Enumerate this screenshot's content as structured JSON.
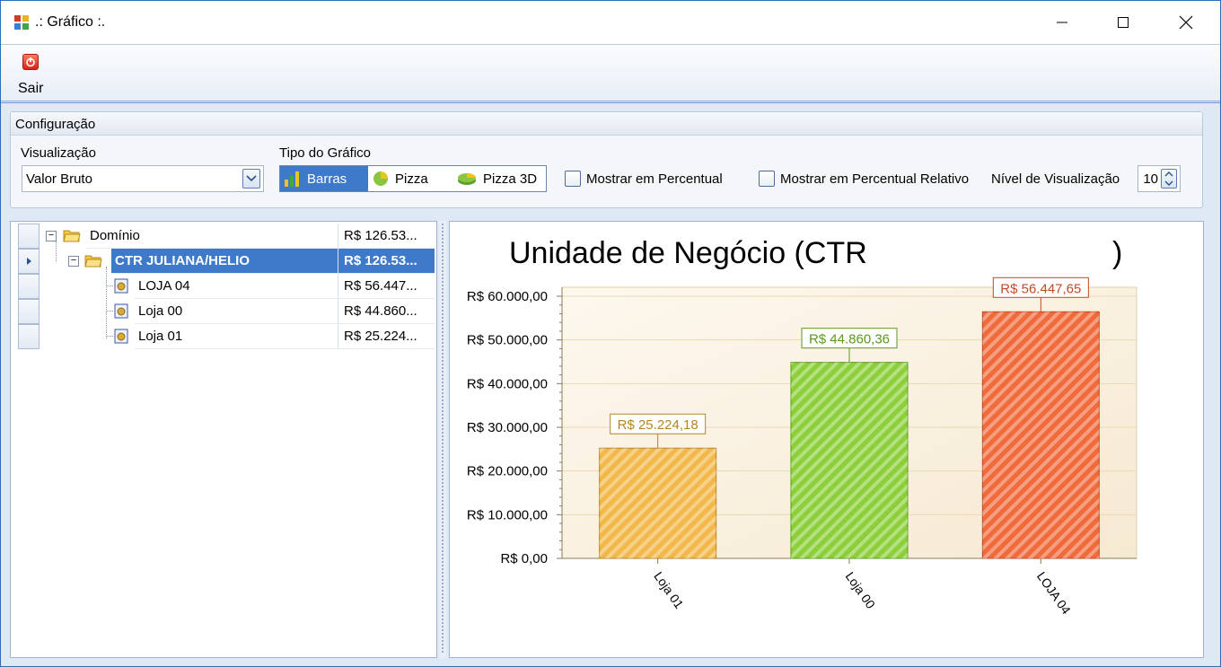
{
  "window": {
    "title": ".: Gráfico :.",
    "controls": [
      "minimize-icon",
      "maximize-icon",
      "close-icon"
    ]
  },
  "toolbar": {
    "exit_label": "Sair",
    "exit_icon": "power-icon"
  },
  "config": {
    "group_title": "Configuração",
    "visualizacao_label": "Visualização",
    "visualizacao_value": "Valor Bruto",
    "tipo_label": "Tipo do Gráfico",
    "chart_types": [
      {
        "label": "Barras",
        "icon": "bar-chart-icon",
        "selected": true
      },
      {
        "label": "Pizza",
        "icon": "pie-chart-icon",
        "selected": false
      },
      {
        "label": "Pizza 3D",
        "icon": "pie-3d-icon",
        "selected": false
      }
    ],
    "percent_label": "Mostrar em Percentual",
    "percent_checked": false,
    "percent_rel_label": "Mostrar em Percentual Relativo",
    "percent_rel_checked": false,
    "nivel_label": "Nível de Visualização",
    "nivel_value": "10"
  },
  "tree": {
    "rows": [
      {
        "name": "Domínio",
        "value": "R$ 126.53...",
        "selected": false
      },
      {
        "name": "CTR JULIANA/HELIO",
        "value": "R$ 126.53...",
        "selected": true
      },
      {
        "name": "LOJA 04",
        "value": "R$ 56.447...",
        "selected": false
      },
      {
        "name": "Loja 00",
        "value": "R$ 44.860...",
        "selected": false
      },
      {
        "name": "Loja 01",
        "value": "R$ 25.224...",
        "selected": false
      }
    ]
  },
  "chart_data": {
    "type": "bar",
    "title": "Unidade de Negócio (CTR",
    "title_end": ")",
    "categories": [
      "Loja 01",
      "Loja 00",
      "LOJA 04"
    ],
    "values": [
      25224.18,
      44860.36,
      56447.65
    ],
    "value_labels": [
      "R$ 25.224,18",
      "R$ 44.860,36",
      "R$ 56.447,65"
    ],
    "colors": [
      "#f2b94a",
      "#8ccf3a",
      "#f06a3c"
    ],
    "label_colors": [
      "#b88322",
      "#5a9a1a",
      "#c24a24"
    ],
    "ylim": [
      0,
      60000
    ],
    "yticks": [
      0,
      10000,
      20000,
      30000,
      40000,
      50000,
      60000
    ],
    "ytick_labels": [
      "R$ 0,00",
      "R$ 10.000,00",
      "R$ 20.000,00",
      "R$ 30.000,00",
      "R$ 40.000,00",
      "R$ 50.000,00",
      "R$ 60.000,00"
    ],
    "grid": true
  }
}
